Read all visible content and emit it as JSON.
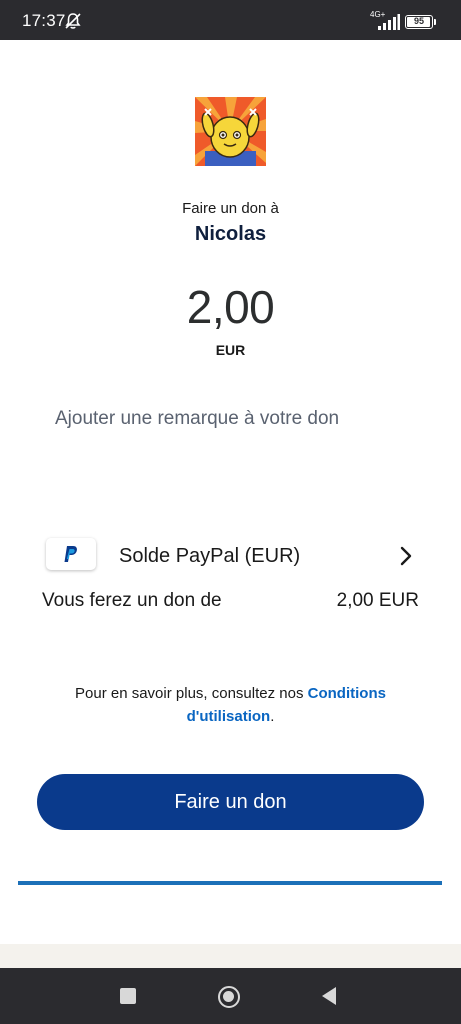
{
  "status_bar": {
    "time": "17:37",
    "network": "4G+",
    "battery": "95",
    "battery_level": 0.95
  },
  "icons": {
    "mute": "notifications-off-icon",
    "signal": "signal-icon",
    "paypal": "paypal-icon",
    "chevron": "chevron-right-icon",
    "recents": "square-icon",
    "home": "circle-icon",
    "back": "triangle-back-icon"
  },
  "donation": {
    "prompt": "Faire un don à",
    "recipient": "Nicolas",
    "amount": "2,00",
    "currency": "EUR",
    "note_placeholder": "Ajouter une remarque à votre don"
  },
  "funding": {
    "source_label": "Solde PayPal (EUR)",
    "summary_label": "Vous ferez un don de",
    "summary_value": "2,00 EUR"
  },
  "terms": {
    "text": "Pour en savoir plus, consultez nos ",
    "link": "Conditions d'utilisation",
    "suffix": "."
  },
  "actions": {
    "donate_label": "Faire un don"
  },
  "progress": {
    "fraction": 1.0
  },
  "colors": {
    "primary_button": "#0a3a8c",
    "link": "#0a66c2",
    "progress": "#1c70b8"
  }
}
